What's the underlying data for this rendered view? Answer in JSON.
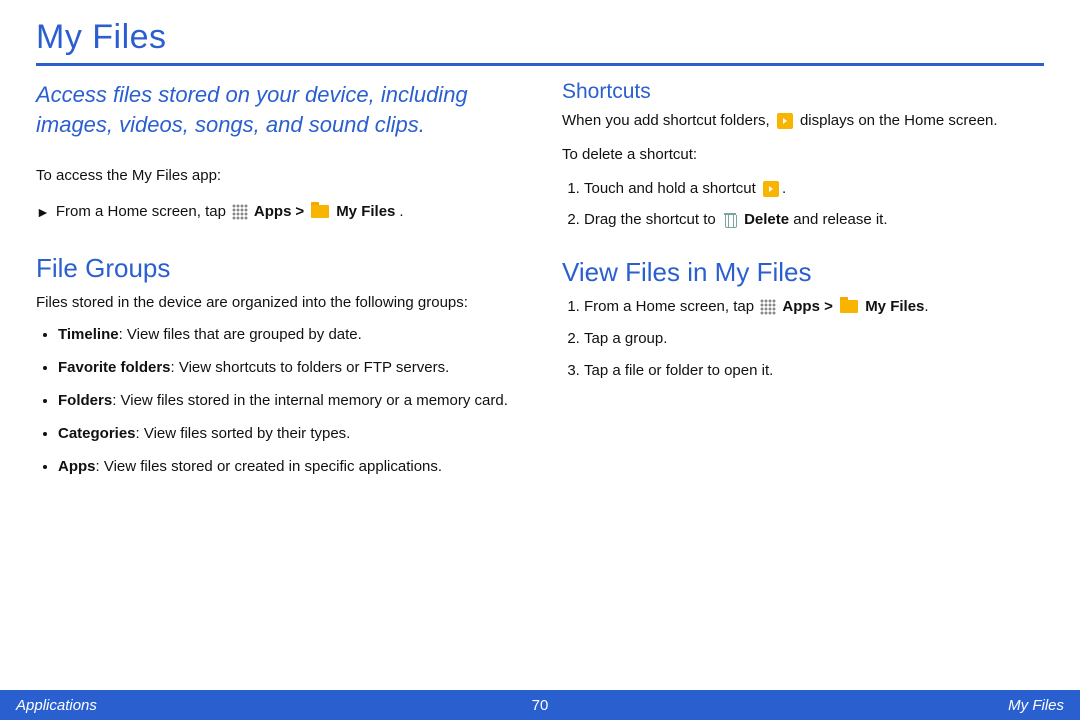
{
  "title": "My Files",
  "intro": "Access files stored on your device, including images, videos, songs, and sound clips.",
  "access": {
    "lead": "To access the My Files app:",
    "step_prefix": "From a Home screen, tap ",
    "apps_label": "Apps",
    "sep": " > ",
    "myfiles_label": "My Files",
    "period": "."
  },
  "fileGroups": {
    "heading": "File Groups",
    "lead": "Files stored in the device are organized into the following groups:",
    "items": [
      {
        "term": "Timeline",
        "desc": ": View files that are grouped by date."
      },
      {
        "term": "Favorite folders",
        "desc": ": View shortcuts to folders or FTP servers."
      },
      {
        "term": "Folders",
        "desc": ": View files stored in the internal memory or a memory card."
      },
      {
        "term": "Categories",
        "desc": ": View files sorted by their types."
      },
      {
        "term": "Apps",
        "desc": ": View files stored or created in specific applications."
      }
    ]
  },
  "shortcuts": {
    "heading": "Shortcuts",
    "line1a": "When you add shortcut folders, ",
    "line1b": " displays on the Home screen.",
    "lead2": "To delete a shortcut:",
    "step1a": "Touch and hold a shortcut ",
    "step1b": ".",
    "step2a": "Drag the shortcut to ",
    "delete_label": "Delete",
    "step2b": " and release it."
  },
  "viewFiles": {
    "heading": "View Files in My Files",
    "step1_prefix": "From a Home screen, tap ",
    "apps_label": "Apps",
    "sep": " > ",
    "myfiles_label": "My Files",
    "period": ".",
    "step2": "Tap a group.",
    "step3": "Tap a file or folder to open it."
  },
  "footer": {
    "left": "Applications",
    "page": "70",
    "right": "My Files"
  }
}
